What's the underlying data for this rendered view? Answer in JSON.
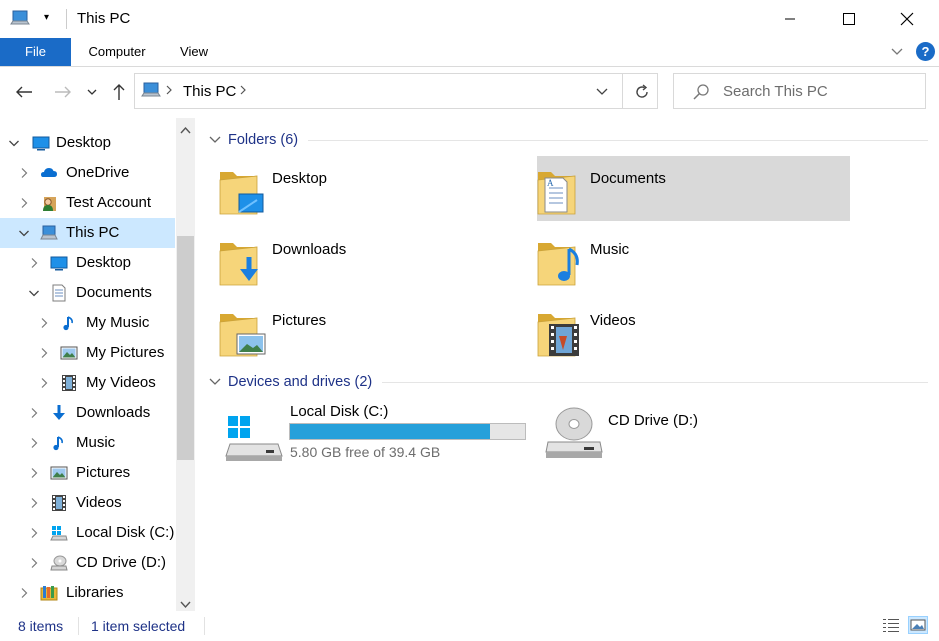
{
  "window": {
    "title": "This PC"
  },
  "ribbon": {
    "tabs": [
      "File",
      "Computer",
      "View"
    ]
  },
  "address": {
    "crumb": "This PC"
  },
  "search": {
    "placeholder": "Search This PC"
  },
  "nav": {
    "items": [
      {
        "label": "Desktop",
        "icon": "desktop-icon"
      },
      {
        "label": "OneDrive",
        "icon": "onedrive-icon"
      },
      {
        "label": "Test Account",
        "icon": "user-icon"
      },
      {
        "label": "This PC",
        "icon": "computer-icon"
      },
      {
        "label": "Desktop",
        "icon": "desktop-icon"
      },
      {
        "label": "Documents",
        "icon": "documents-icon"
      },
      {
        "label": "My Music",
        "icon": "music-icon"
      },
      {
        "label": "My Pictures",
        "icon": "pictures-icon"
      },
      {
        "label": "My Videos",
        "icon": "videos-icon"
      },
      {
        "label": "Downloads",
        "icon": "downloads-icon"
      },
      {
        "label": "Music",
        "icon": "music-icon"
      },
      {
        "label": "Pictures",
        "icon": "pictures-icon"
      },
      {
        "label": "Videos",
        "icon": "videos-icon"
      },
      {
        "label": "Local Disk (C:)",
        "icon": "drive-icon"
      },
      {
        "label": "CD Drive (D:)",
        "icon": "cd-drive-icon"
      },
      {
        "label": "Libraries",
        "icon": "libraries-icon"
      }
    ]
  },
  "content": {
    "folders_header": "Folders (6)",
    "folders": [
      {
        "label": "Desktop",
        "icon": "desktop-folder-icon"
      },
      {
        "label": "Documents",
        "icon": "documents-folder-icon"
      },
      {
        "label": "Downloads",
        "icon": "downloads-folder-icon"
      },
      {
        "label": "Music",
        "icon": "music-folder-icon"
      },
      {
        "label": "Pictures",
        "icon": "pictures-folder-icon"
      },
      {
        "label": "Videos",
        "icon": "videos-folder-icon"
      }
    ],
    "drives_header": "Devices and drives (2)",
    "drives": [
      {
        "label": "Local Disk (C:)",
        "free": "5.80 GB free of 39.4 GB",
        "used_fraction": 0.853
      },
      {
        "label": "CD Drive (D:)"
      }
    ]
  },
  "status": {
    "items": "8 items",
    "selected": "1 item selected"
  },
  "colors": {
    "accent": "#1a6bc7",
    "selection": "#cce8ff",
    "tile_selected": "#d9d9d9",
    "drive_bar": "#26a0da",
    "header_text": "#1e3287"
  }
}
